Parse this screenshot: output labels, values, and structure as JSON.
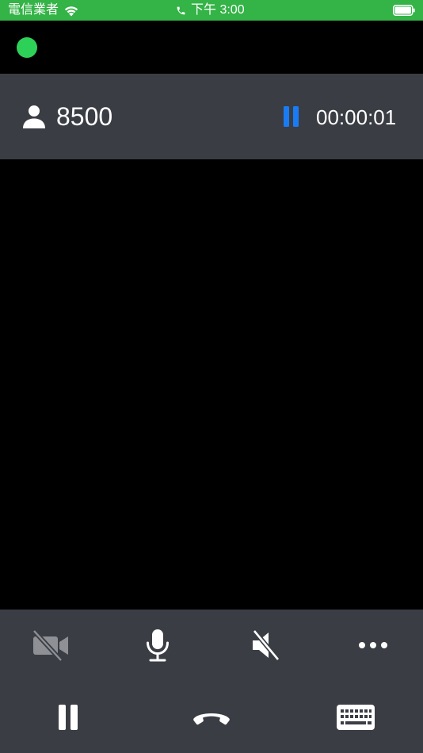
{
  "status_bar": {
    "carrier": "電信業者",
    "time": "下午 3:00",
    "icons": [
      "wifi-icon",
      "phone-icon",
      "battery-icon"
    ],
    "background_color": "#34b347"
  },
  "connection_status": {
    "indicator_color": "#2ed158"
  },
  "call": {
    "number": "8500",
    "timer": "00:00:01",
    "hold_indicator_color": "#1a7cf5"
  },
  "controls": {
    "row1": [
      "video-off-icon",
      "microphone-icon",
      "speaker-muted-icon",
      "more-icon"
    ],
    "row2": [
      "pause-icon",
      "hang-up-icon",
      "keypad-icon"
    ]
  },
  "colors": {
    "panel": "#3a3d44",
    "icon_active": "#ffffff",
    "icon_disabled": "#8e9096"
  }
}
